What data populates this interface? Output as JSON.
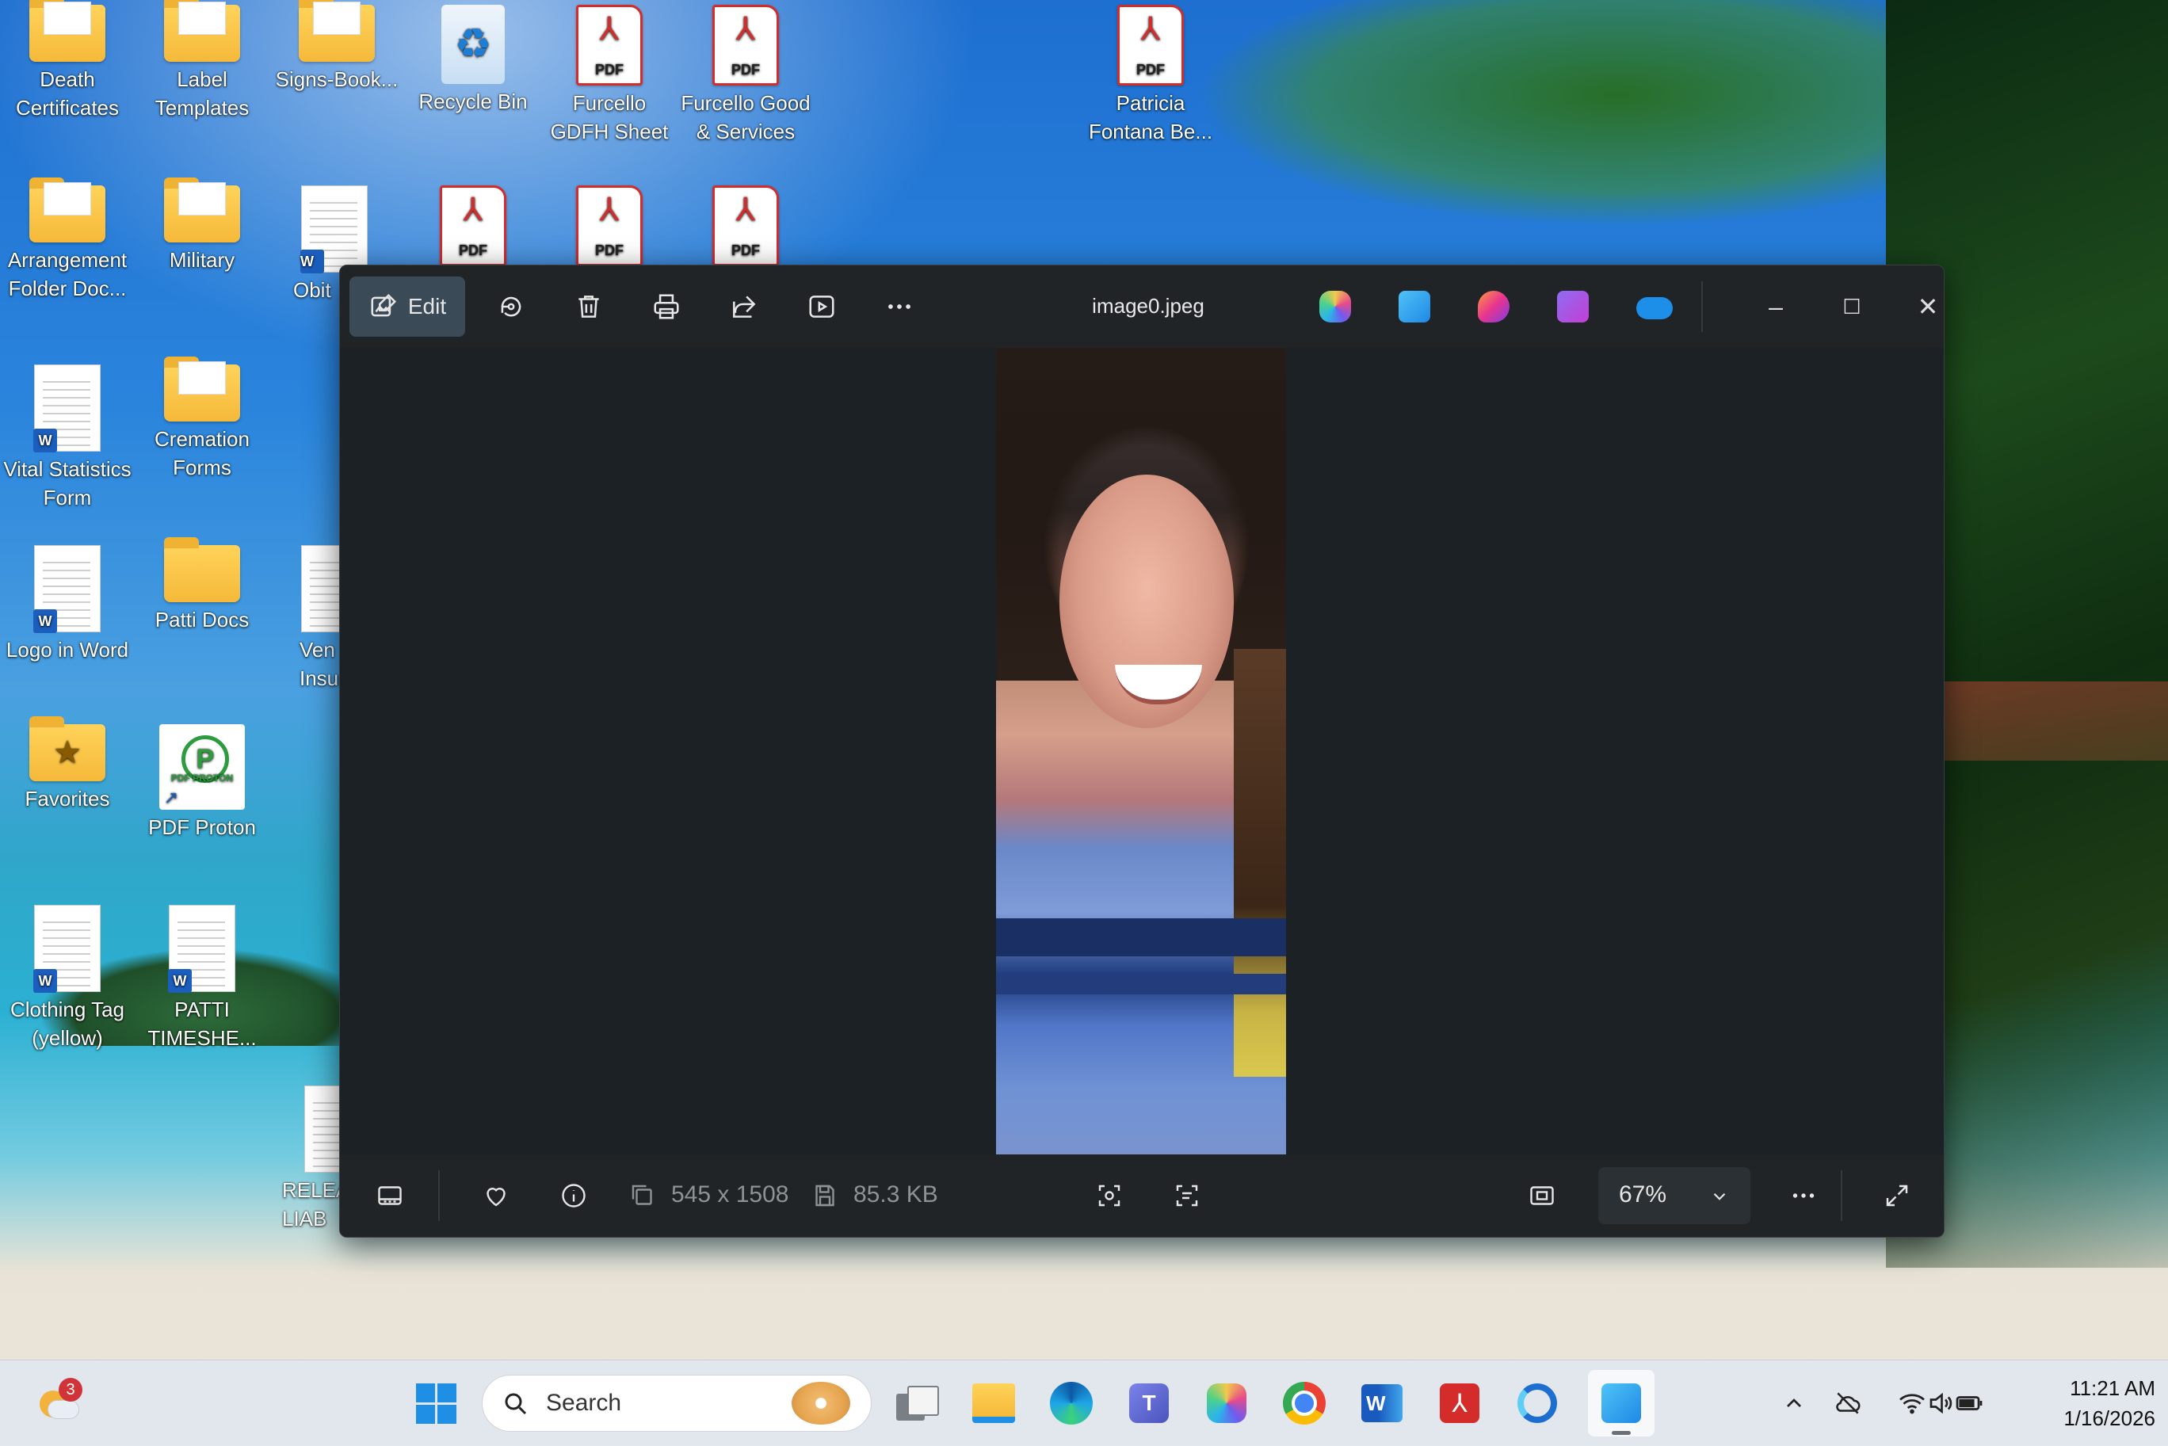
{
  "desktop": {
    "icons": [
      {
        "label": "Death Certificates"
      },
      {
        "label": "Label Templates"
      },
      {
        "label": "Signs-Book..."
      },
      {
        "label": "Recycle Bin"
      },
      {
        "label": "Furcello GDFH Sheet"
      },
      {
        "label": "Furcello Good & Services"
      },
      {
        "label": "Patricia Fontana Be..."
      },
      {
        "label": "Arrangement Folder Doc..."
      },
      {
        "label": "Military"
      },
      {
        "label": "Obit"
      },
      {
        "label": "Vital Statistics Form"
      },
      {
        "label": "Cremation Forms"
      },
      {
        "label": "Logo in Word"
      },
      {
        "label": "Patti Docs"
      },
      {
        "label": "Ven Insura"
      },
      {
        "label": "Favorites"
      },
      {
        "label": "PDF Proton"
      },
      {
        "label": "Clothing Tag (yellow)"
      },
      {
        "label": "PATTI TIMESHE..."
      },
      {
        "label": "RELEA LIAB"
      }
    ],
    "pdf_badge": "PDF",
    "word_badge": "W",
    "proton_text": "PDF PROTON"
  },
  "photos": {
    "edit_label": "Edit",
    "title": "image0.jpeg",
    "dimensions": "545 x 1508",
    "file_size": "85.3 KB",
    "zoom": "67%"
  },
  "taskbar": {
    "search_placeholder": "Search",
    "weather_badge": "3",
    "time": "11:21 AM",
    "date": "1/16/2026"
  },
  "colors": {
    "accent": "#0078d4",
    "pdf_red": "#d42b2b",
    "window_bg": "#1c2125"
  }
}
